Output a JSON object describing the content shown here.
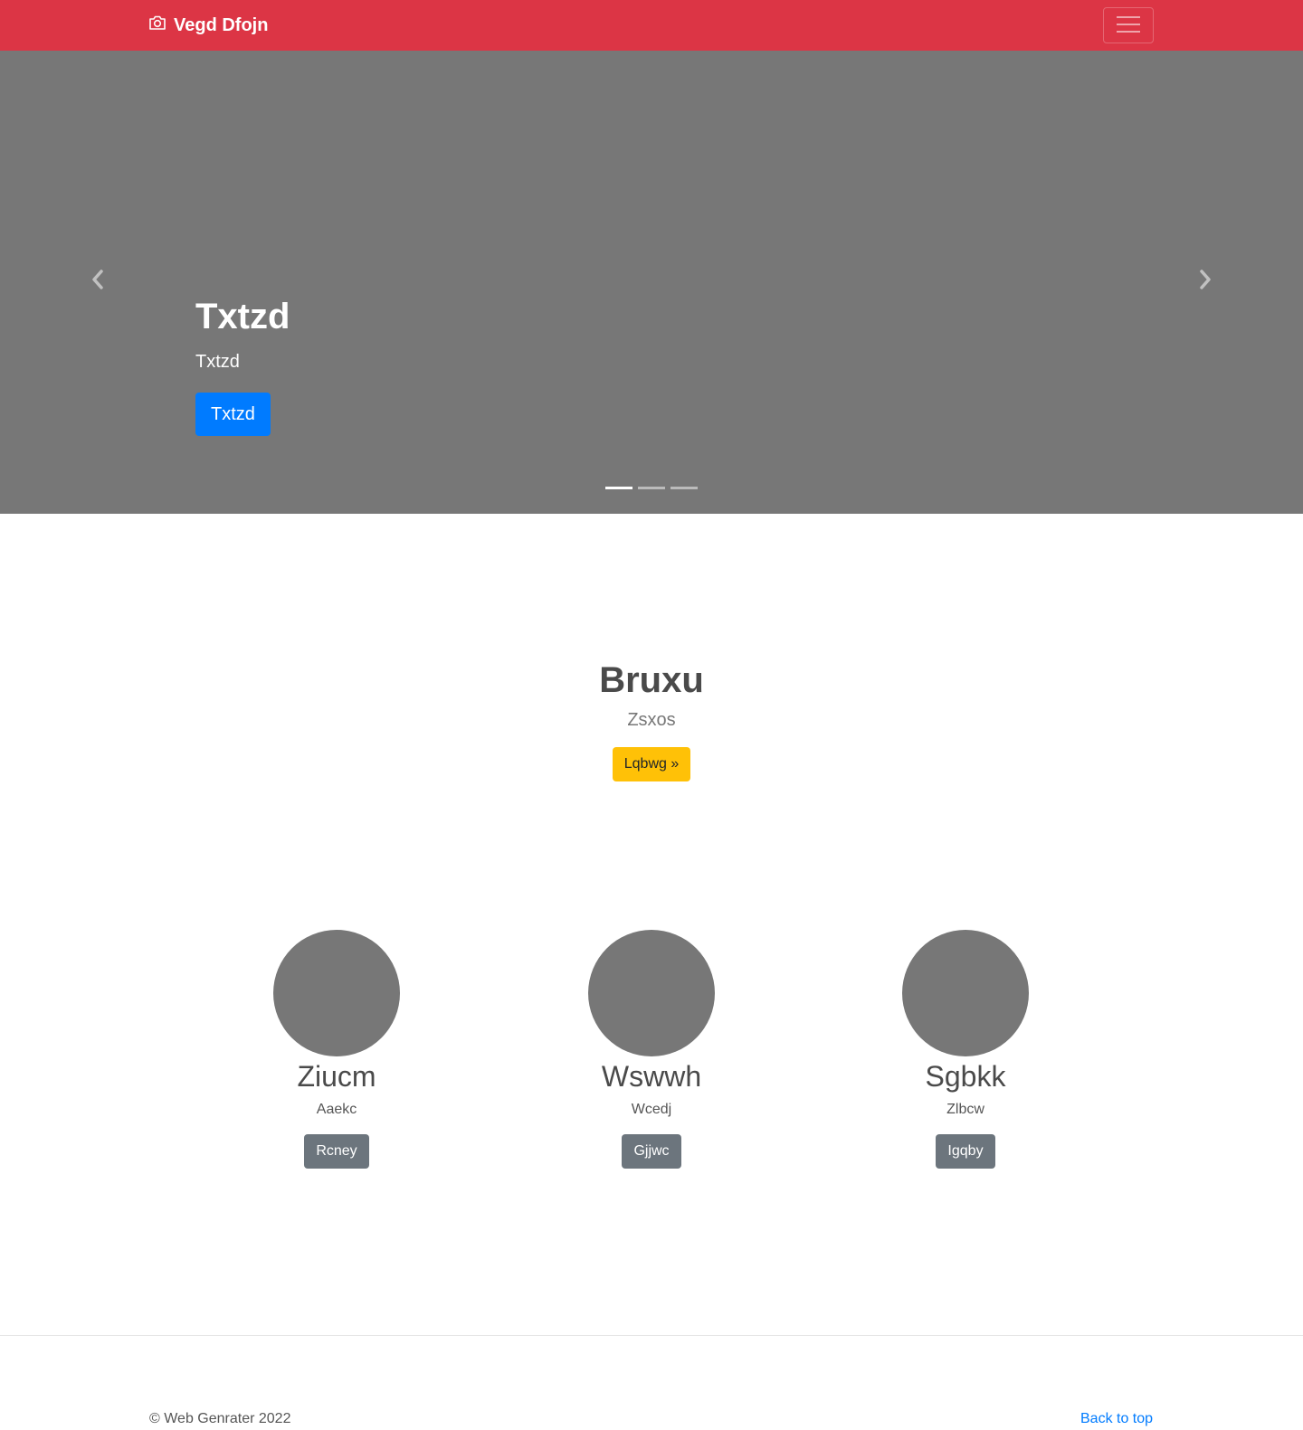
{
  "navbar": {
    "brand": "Vegd Dfojn",
    "brand_icon": "camera-icon",
    "toggler_icon": "hamburger-menu-icon",
    "background": "#dc3545"
  },
  "carousel": {
    "slide_title": "Txtzd",
    "slide_text": "Txtzd",
    "slide_button": "Txtzd",
    "prev_icon": "chevron-left-icon",
    "next_icon": "chevron-right-icon",
    "slide_count": 3,
    "active_slide": 1,
    "background": "#777777"
  },
  "jumbotron": {
    "title": "Bruxu",
    "subtitle": "Zsxos",
    "button": "Lqbwg »"
  },
  "features": [
    {
      "title": "Ziucm",
      "text": "Aaekc",
      "button": "Rcney"
    },
    {
      "title": "Wswwh",
      "text": "Wcedj",
      "button": "Gjjwc"
    },
    {
      "title": "Sgbkk",
      "text": "Zlbcw",
      "button": "Igqby"
    }
  ],
  "footer": {
    "copyright": "© Web Genrater 2022",
    "back_to_top": "Back to top"
  },
  "colors": {
    "primary": "#007bff",
    "warning": "#ffc107",
    "secondary": "#6c757d",
    "danger": "#dc3545"
  }
}
